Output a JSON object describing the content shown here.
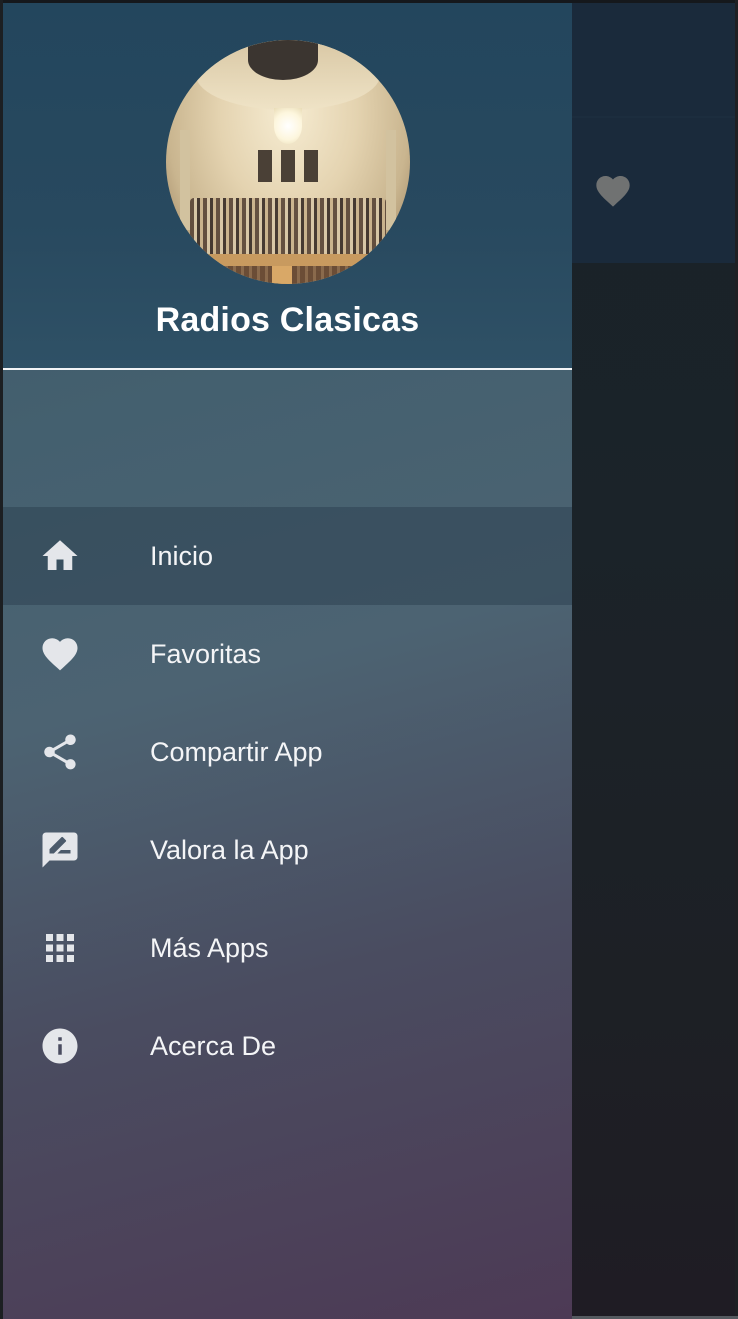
{
  "drawer": {
    "header": {
      "title": "Radios Clasicas",
      "avatar": "concert-hall-image"
    },
    "menu": [
      {
        "label": "Inicio",
        "icon": "home-icon",
        "active": true
      },
      {
        "label": "Favoritas",
        "icon": "heart-icon",
        "active": false
      },
      {
        "label": "Compartir App",
        "icon": "share-icon",
        "active": false
      },
      {
        "label": "Valora la App",
        "icon": "rate-review-icon",
        "active": false
      },
      {
        "label": "Más Apps",
        "icon": "apps-grid-icon",
        "active": false
      },
      {
        "label": "Acerca De",
        "icon": "info-icon",
        "active": false
      }
    ]
  },
  "background_app": {
    "toolbar_icon": "favorite-heart-icon"
  },
  "colors": {
    "header_bg": "#23465d",
    "drawer_gradient_top": "#44606f",
    "drawer_gradient_bottom": "#4d3a55",
    "text_primary": "#ffffff",
    "icon_color": "#e4e6ea",
    "background_toolbar": "#1a2a3b"
  }
}
